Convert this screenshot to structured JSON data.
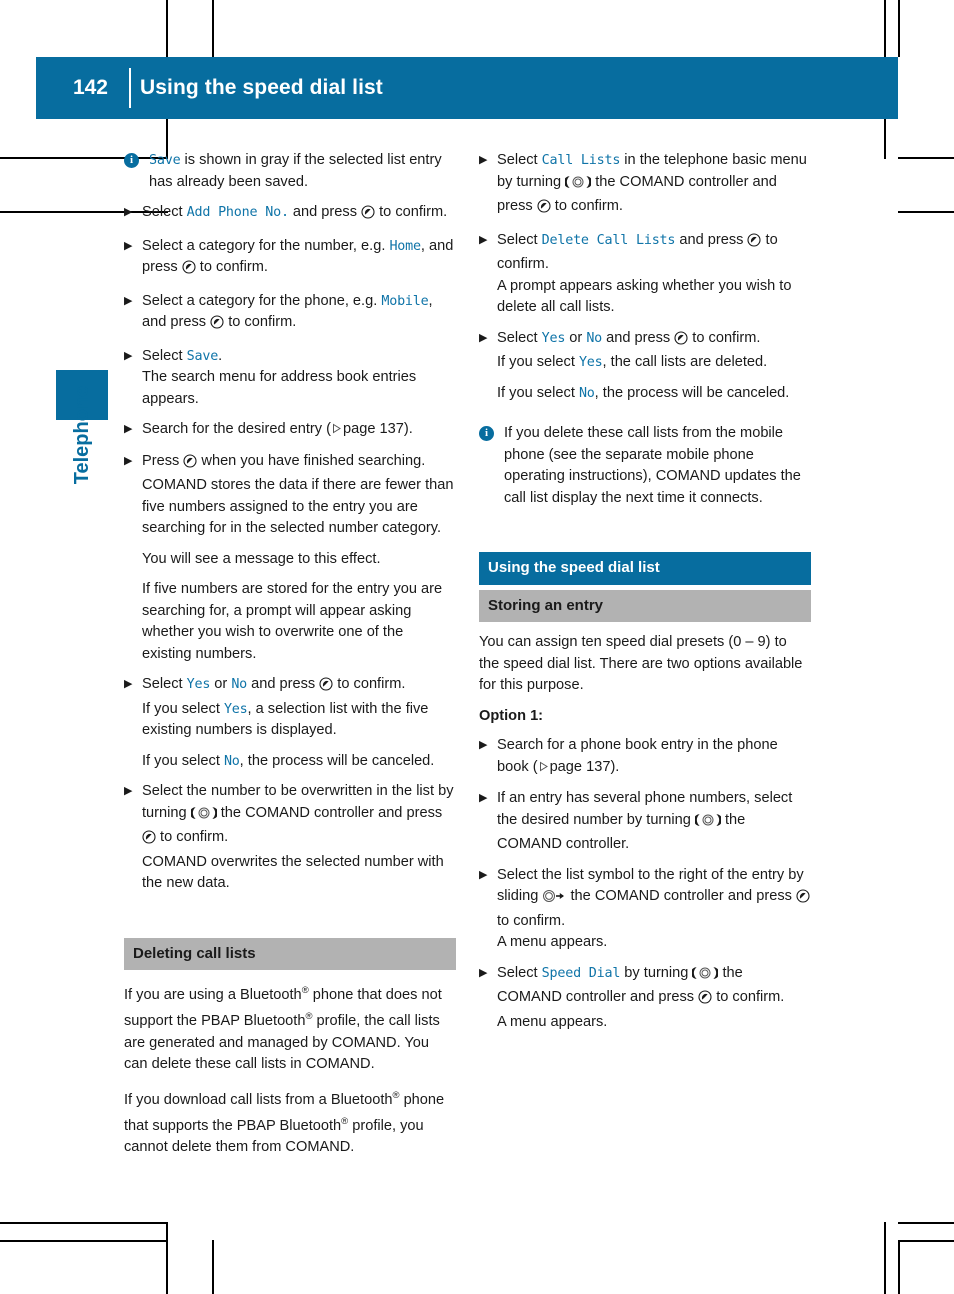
{
  "header": {
    "page_number": "142",
    "title": "Using the speed dial list"
  },
  "chapter_tab": {
    "label": "Telephone"
  },
  "colors": {
    "accent_blue": "#076d9f",
    "command_text_blue": "#0f74a8",
    "heading_gray": "#b2b2b2"
  },
  "icons": {
    "info": "information-icon",
    "turn": "comand-controller-turn-icon",
    "press": "comand-controller-press-icon",
    "slide_right": "comand-controller-slide-right-icon",
    "page_ref": "page-reference-triangle-icon",
    "step": "step-bullet-triangle-icon"
  },
  "left_column": {
    "note_1": {
      "pre": "",
      "cmd": "Save",
      "post": " is shown in gray if the selected list entry has already been saved."
    },
    "step_add_phone": {
      "a": "Select ",
      "cmd": "Add Phone No.",
      "b": " and press ",
      "c": " to confirm."
    },
    "step_category_number": {
      "a": "Select a category for the number, e.g. ",
      "cmd": "Home",
      "b": ", and press ",
      "c": " to confirm."
    },
    "step_category_phone": {
      "a": "Select a category for the phone, e.g. ",
      "cmd": "Mobile",
      "b": ", and press ",
      "c": " to confirm."
    },
    "step_save": {
      "a": "Select ",
      "cmd": "Save",
      "b": ".",
      "sub": "The search menu for address book entries appears."
    },
    "step_search": {
      "a": "Search for the desired entry (",
      "ref": "page 137",
      "b": ")."
    },
    "step_press_finished": {
      "a": "Press ",
      "b": " when you have finished searching.",
      "sub1": "COMAND stores the data if there are fewer than five numbers assigned to the entry you are searching for in the selected number category.",
      "sub2": "You will see a message to this effect.",
      "sub3": "If five numbers are stored for the entry you are searching for, a prompt will appear asking whether you wish to overwrite one of the existing numbers."
    },
    "step_yes_no": {
      "a": "Select ",
      "cmd_yes": "Yes",
      "b": " or ",
      "cmd_no": "No",
      "c": " and press ",
      "d": " to confirm.",
      "sub1_a": "If you select ",
      "sub1_cmd": "Yes",
      "sub1_b": ", a selection list with the five existing numbers is displayed.",
      "sub2_a": "If you select ",
      "sub2_cmd": "No",
      "sub2_b": ", the process will be canceled."
    },
    "step_overwrite": {
      "a": "Select the number to be overwritten in the list by turning ",
      "b": " the COMAND controller and press ",
      "c": " to confirm.",
      "sub": "COMAND overwrites the selected number with the new data."
    },
    "heading_deleting": "Deleting call lists",
    "para_bluetooth_1": {
      "a": "If you are using a Bluetooth",
      "sup1": "®",
      "b": " phone that does not support the PBAP Bluetooth",
      "sup2": "®",
      "c": " profile, the call lists are generated and managed by COMAND. You can delete these call lists in COMAND."
    },
    "para_bluetooth_2": {
      "a": "If you download call lists from a Bluetooth",
      "sup1": "®",
      "b": " phone that supports the PBAP Bluetooth",
      "sup2": "®",
      "c": " profile, you cannot delete them from COMAND."
    }
  },
  "right_column": {
    "step_call_lists": {
      "a": "Select ",
      "cmd": "Call Lists",
      "b": " in the telephone basic menu by turning ",
      "c": " the COMAND controller and press ",
      "d": " to confirm."
    },
    "step_delete_call_lists": {
      "a": "Select ",
      "cmd": "Delete Call Lists",
      "b": " and press ",
      "c": " to confirm.",
      "sub": "A prompt appears asking whether you wish to delete all call lists."
    },
    "step_yes_no": {
      "a": "Select ",
      "cmd_yes": "Yes",
      "b": " or ",
      "cmd_no": "No",
      "c": " and press ",
      "d": " to confirm.",
      "sub1_a": "If you select ",
      "sub1_cmd": "Yes",
      "sub1_b": ", the call lists are deleted.",
      "sub2_a": "If you select ",
      "sub2_cmd": "No",
      "sub2_b": ", the process will be canceled."
    },
    "note_1": "If you delete these call lists from the mobile phone (see the separate mobile phone operating instructions), COMAND updates the call list display the next time it connects.",
    "heading_blue": "Using the speed dial list",
    "heading_gray": "Storing an entry",
    "para_presets": "You can assign ten speed dial presets (0 – 9) to the speed dial list. There are two options available for this purpose.",
    "option_label": "Option 1:",
    "step_search_book": {
      "a": "Search for a phone book entry in the phone book (",
      "ref": "page 137",
      "b": ")."
    },
    "step_several_numbers": {
      "a": "If an entry has several phone numbers, select the desired number by turning ",
      "b": " the COMAND controller."
    },
    "step_list_symbol": {
      "a": "Select the list symbol to the right of the entry by sliding ",
      "b": " the COMAND controller and press ",
      "c": " to confirm.",
      "sub": "A menu appears."
    },
    "step_speed_dial": {
      "a": "Select ",
      "cmd": "Speed Dial",
      "b": " by turning ",
      "c": " the COMAND controller and press ",
      "d": " to confirm.",
      "sub": "A menu appears."
    }
  }
}
